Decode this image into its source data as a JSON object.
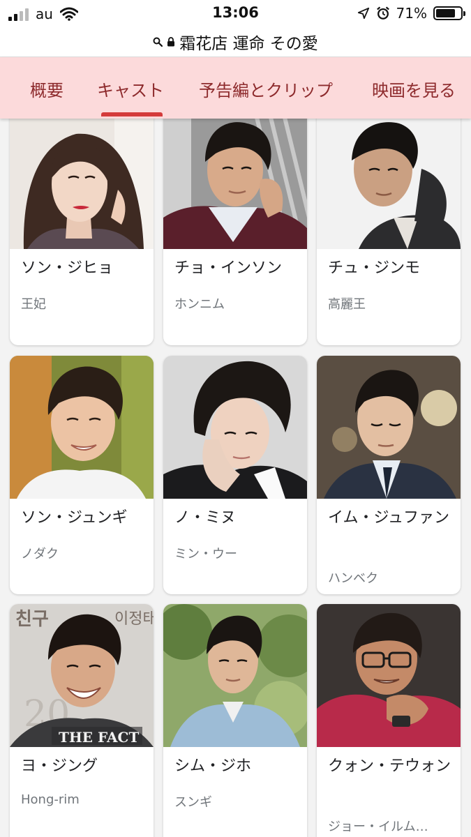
{
  "status_bar": {
    "carrier": "au",
    "time": "13:06",
    "battery": "71%",
    "battery_level": 0.71
  },
  "url_bar": {
    "text": "霜花店 運命 その愛"
  },
  "tabs": [
    {
      "label": "概要",
      "active": false
    },
    {
      "label": "キャスト",
      "active": true
    },
    {
      "label": "予告編とクリップ",
      "active": false
    },
    {
      "label": "映画を見る",
      "active": false
    }
  ],
  "cast": [
    {
      "name": "ソン・ジヒョ",
      "role": "王妃"
    },
    {
      "name": "チョ・インソン",
      "role": "ホンニム"
    },
    {
      "name": "チュ・ジンモ",
      "role": "高麗王"
    },
    {
      "name": "ソン・ジュンギ",
      "role": "ノダク"
    },
    {
      "name": "ノ・ミヌ",
      "role": "ミン・ウー"
    },
    {
      "name": "イム・ジュファン",
      "role": "ハンベク"
    },
    {
      "name": "ヨ・ジング",
      "role": "Hong-rim",
      "photo_caption": "THE FACT"
    },
    {
      "name": "シム・ジホ",
      "role": "スンギ"
    },
    {
      "name": "クォン・テウォン",
      "role": "ジョー・イルム…"
    }
  ],
  "colors": {
    "tab_bar_bg": "#fcdadb",
    "tab_text": "#8d2a2c",
    "tab_indicator": "#d43b3b",
    "page_bg": "#f3f3f3"
  }
}
